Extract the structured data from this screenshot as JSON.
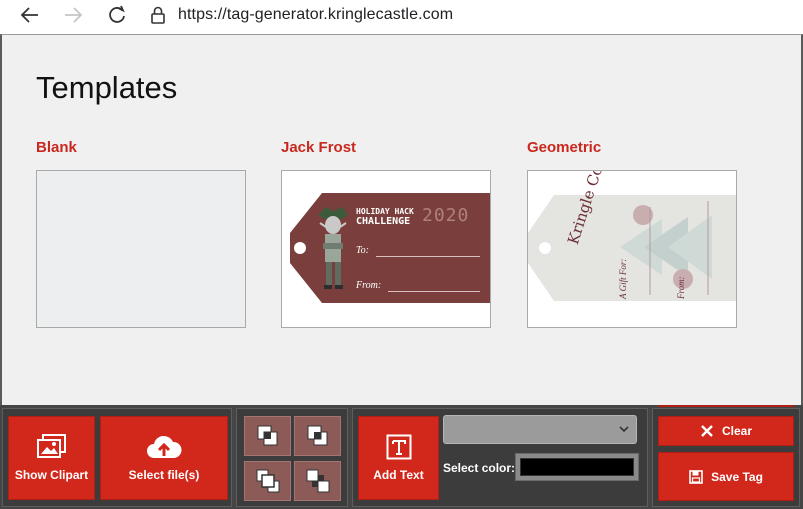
{
  "browser": {
    "url": "https://tag-generator.kringlecastle.com"
  },
  "page": {
    "title": "Templates",
    "templates": [
      {
        "name": "Blank"
      },
      {
        "name": "Jack Frost",
        "line1": "HOLIDAY HACK",
        "line2": "CHALLENGE",
        "year": "2020",
        "to_label": "To:",
        "from_label": "From:"
      },
      {
        "name": "Geometric",
        "brand": "Kringle Con",
        "gift_label": "A Gift For:",
        "from_label": "From:"
      }
    ]
  },
  "toolbar": {
    "show_clipart": "Show Clipart",
    "select_files": "Select file(s)",
    "add_text": "Add Text",
    "select_color_label": "Select color:",
    "selected_color": "#000000",
    "font_select_value": "",
    "clear": "Clear",
    "save_tag": "Save Tag"
  },
  "colors": {
    "accent_red": "#d2281c",
    "template_name_red": "#c8281f",
    "toolbar_bg": "#454545",
    "layer_button": "#8c5a57"
  }
}
